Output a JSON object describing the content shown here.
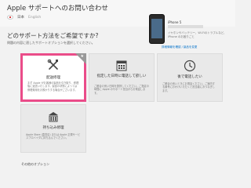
{
  "header": {
    "title": "Apple サポートへのお問い合わせ",
    "country": "日本",
    "language": "English"
  },
  "intro": {
    "headline": "どのサポート方法をご希望ですか?",
    "sub": "問題の内容に適したサポートオプションを選択してください。"
  },
  "device": {
    "name": "iPhone 5",
    "desc": "イヤホンやバッテリー、Wi-Fiのトラブルなど、iPhone のお困りごと",
    "link": "詳細情報を確認 / 製品を変更"
  },
  "options": [
    {
      "title": "配送修理",
      "desc": "まず Apple がお客様の製品を引き取り、修理後に返送いたします。製品の状態によっては修理費用をお預かりする場合がございます。",
      "icon": "tools-icon"
    },
    {
      "title": "指定した日時に電話して欲しい",
      "desc": "ご都合の良い日時を選択してください。ご指定の時間に Apple のサポート担当からお電話します。",
      "icon": "calendar-icon"
    },
    {
      "title": "後で電話したい",
      "desc": "ご都合の良いときにお電話ください。ご案内する番号におかけいただくと担当者におつなぎします。",
      "icon": "clock-icon"
    },
    {
      "title": "持ち込み修理",
      "desc": "Apple Store (直営店) または Apple 正規サービスプロバイダに持ち込んでください。",
      "icon": "store-icon"
    }
  ],
  "footer": {
    "more": "その他のオプション"
  },
  "colors": {
    "accent": "#ea4c89",
    "link": "#0070c9",
    "card": "#e9e9e9"
  }
}
